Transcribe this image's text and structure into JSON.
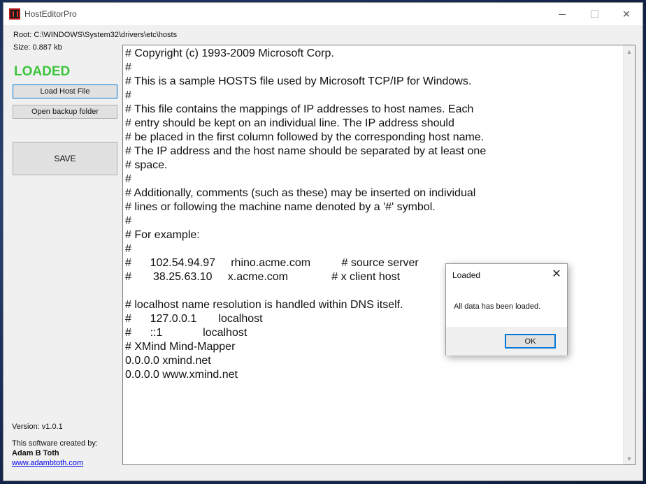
{
  "window": {
    "title": "HostEditorPro",
    "controls": {
      "minimize": "—",
      "maximize": "☐",
      "close": "✕"
    }
  },
  "info": {
    "root": "Root: C:\\WINDOWS\\System32\\drivers\\etc\\hosts",
    "size": "Size: 0.887 kb",
    "status": "LOADED",
    "status_color": "#3cc43c"
  },
  "buttons": {
    "load": "Load Host File",
    "backup": "Open backup folder",
    "save": "SAVE"
  },
  "footer": {
    "version": "Version: v1.0.1",
    "created_by": "This software created by:",
    "author": "Adam B Toth",
    "website": "www.adambtoth.com"
  },
  "editor": {
    "content": "# Copyright (c) 1993-2009 Microsoft Corp.\n#\n# This is a sample HOSTS file used by Microsoft TCP/IP for Windows.\n#\n# This file contains the mappings of IP addresses to host names. Each\n# entry should be kept on an individual line. The IP address should\n# be placed in the first column followed by the corresponding host name.\n# The IP address and the host name should be separated by at least one\n# space.\n#\n# Additionally, comments (such as these) may be inserted on individual\n# lines or following the machine name denoted by a '#' symbol.\n#\n# For example:\n#\n#      102.54.94.97     rhino.acme.com          # source server\n#       38.25.63.10     x.acme.com              # x client host\n\n# localhost name resolution is handled within DNS itself.\n#\t127.0.0.1       localhost\n#\t::1             localhost\n# XMind Mind-Mapper\n0.0.0.0 xmind.net\n0.0.0.0 www.xmind.net"
  },
  "dialog": {
    "title": "Loaded",
    "message": "All data has been loaded.",
    "ok": "OK",
    "close": "✕"
  }
}
